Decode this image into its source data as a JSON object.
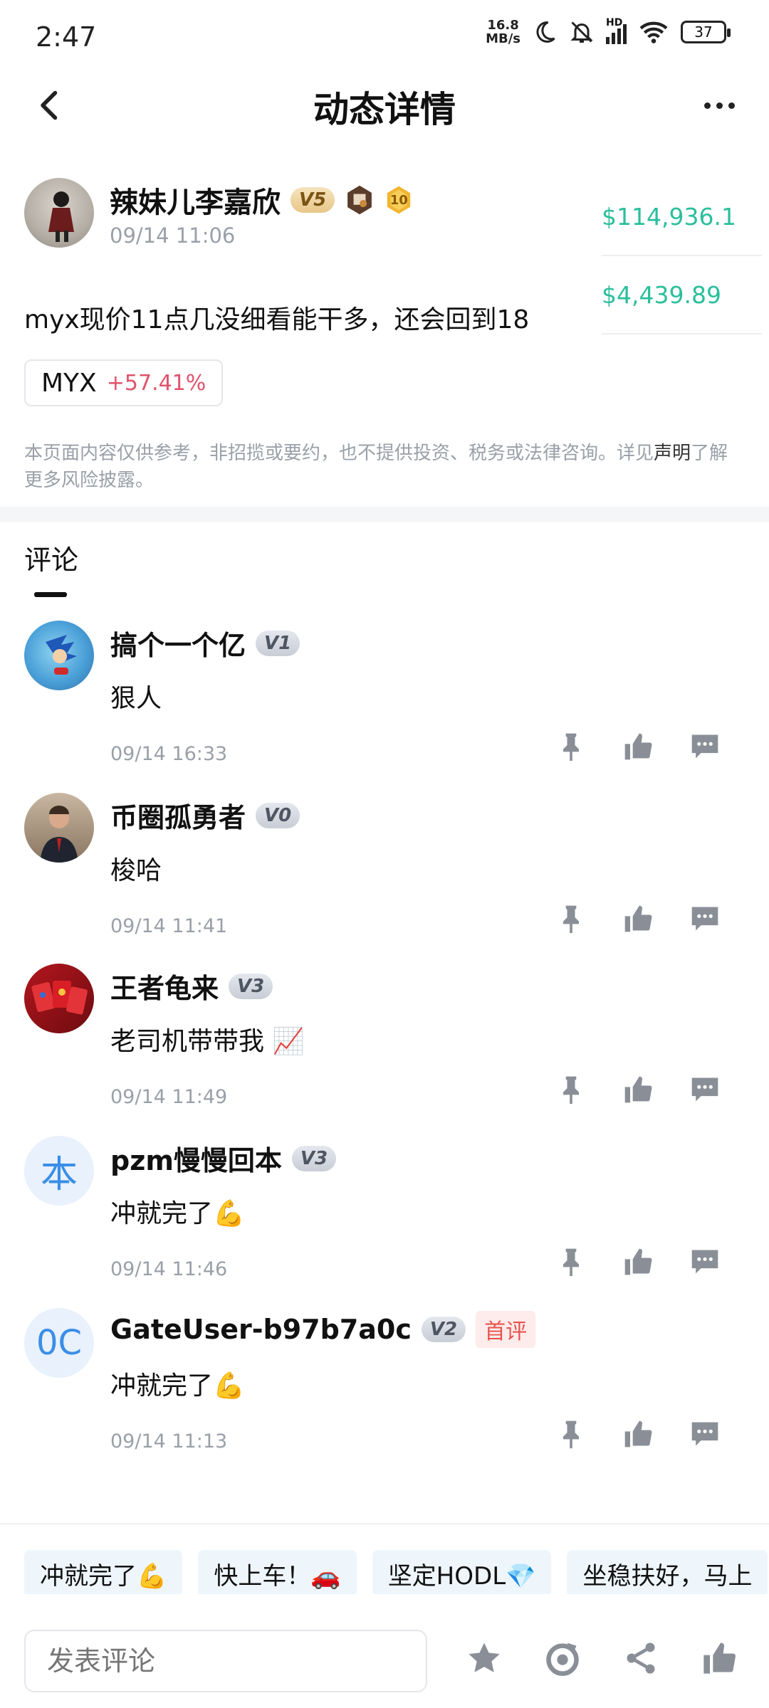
{
  "status_bar": {
    "time": "2:47",
    "net_speed_top": "16.8",
    "net_speed_bottom": "MB/s",
    "signal_label": "HD",
    "battery": "37"
  },
  "header": {
    "title": "动态详情"
  },
  "post": {
    "author": "辣妹儿李嘉欣",
    "level": "V5",
    "rank_badge": "10",
    "time": "09/14 11:06",
    "text": "myx现价11点几没细看能干多，还会回到18",
    "coin": {
      "symbol": "MYX",
      "change": "+57.41%"
    },
    "prices": [
      "$114,936.1",
      "$4,439.89"
    ],
    "disclaimer_main": "本页面内容仅供参考，非招揽或要约，也不提供投资、税务或法律咨询。详见",
    "disclaimer_link": "声明",
    "disclaimer_tail": "了解更多风险披露。"
  },
  "comments_section": {
    "title": "评论",
    "items": [
      {
        "name": "搞个一个亿",
        "level": "V1",
        "text": "狠人",
        "time": "09/14 16:33",
        "avatar": "sonic-avatar"
      },
      {
        "name": "币圈孤勇者",
        "level": "V0",
        "text": "梭哈",
        "time": "09/14 11:41",
        "avatar": "suit-man-avatar"
      },
      {
        "name": "王者龟来",
        "level": "V3",
        "text": "老司机带带我 📈",
        "time": "09/14 11:49",
        "avatar": "red-envelope-avatar"
      },
      {
        "name": "pzm慢慢回本",
        "level": "V3",
        "text": "冲就完了💪",
        "time": "09/14 11:46",
        "avatar_letter": "本"
      },
      {
        "name": "GateUser-b97b7a0c",
        "level": "V2",
        "first_badge": "首评",
        "text": "冲就完了💪",
        "time": "09/14 11:13",
        "avatar_letter": "0C"
      }
    ]
  },
  "quick_replies": [
    "冲就完了💪",
    "快上车！🚗",
    "坚定HODL💎",
    "坐稳扶好，马上"
  ],
  "bottom_bar": {
    "input_placeholder": "发表评论"
  },
  "colors": {
    "price_green": "#2bbf9c",
    "gain_red": "#e0536b",
    "first_comment_red": "#e8544e",
    "letter_avatar_blue": "#3a8ee6",
    "icon_gray": "#8a8f97"
  }
}
